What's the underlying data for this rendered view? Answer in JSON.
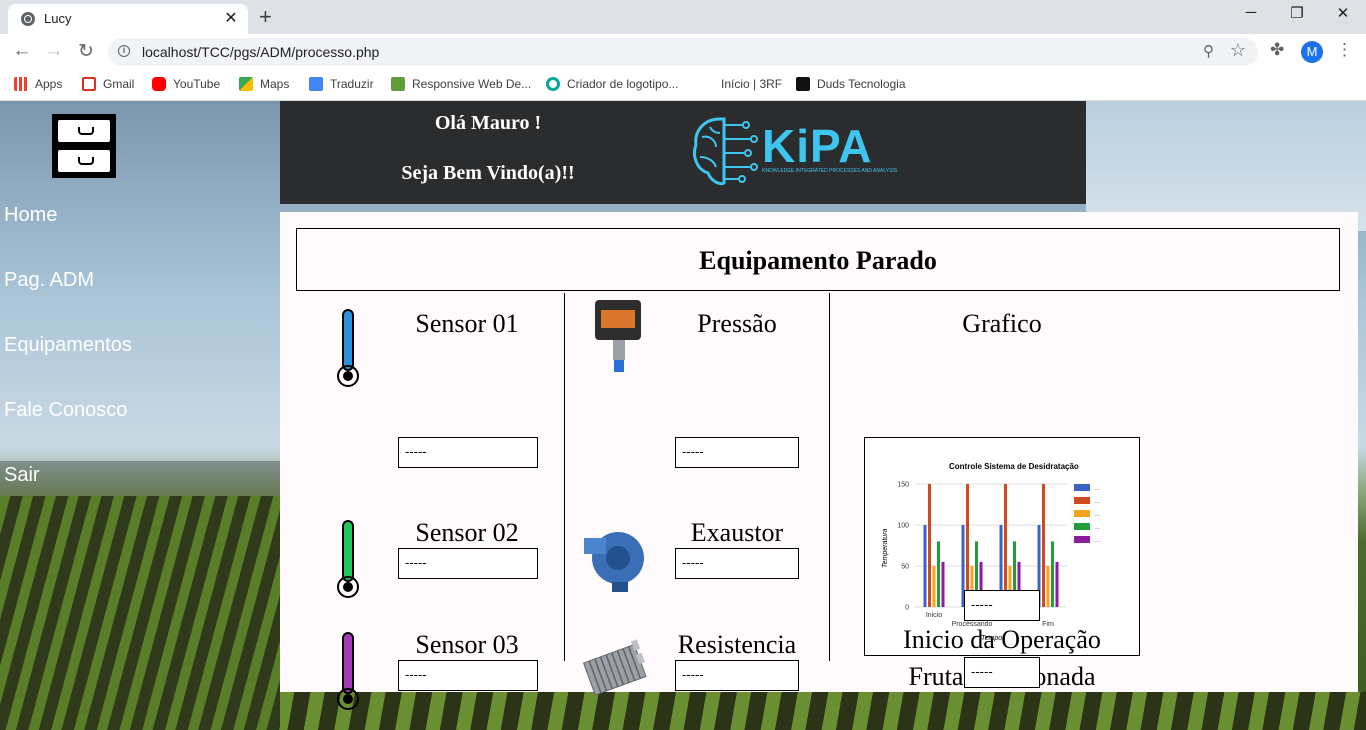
{
  "browser": {
    "tab_title": "Lucy",
    "tab_close": "✕",
    "new_tab": "+",
    "url": "localhost/TCC/pgs/ADM/processo.php",
    "avatar_letter": "M",
    "bookmarks": [
      {
        "label": "Apps",
        "color": "#ea4335"
      },
      {
        "label": "Gmail",
        "color": "#d93025"
      },
      {
        "label": "YouTube",
        "color": "#ff0000"
      },
      {
        "label": "Maps",
        "color": "#34a853"
      },
      {
        "label": "Traduzir",
        "color": "#4285f4"
      },
      {
        "label": "Responsive Web De...",
        "color": "#5f9e3a"
      },
      {
        "label": "Criador de logotipo...",
        "color": "#00a99d"
      },
      {
        "label": "Início | 3RF",
        "color": "#ffffff"
      },
      {
        "label": "Duds Tecnologia",
        "color": "#111111"
      }
    ]
  },
  "sidebar": {
    "items": [
      {
        "label": "Home"
      },
      {
        "label": "Pag. ADM"
      },
      {
        "label": "Equipamentos"
      },
      {
        "label": "Fale Conosco"
      },
      {
        "label": "Sair"
      }
    ]
  },
  "header": {
    "greeting": "Olá Mauro !",
    "welcome": "Seja Bem Vindo(a)!!",
    "logo_text": "KiPA",
    "logo_subtitle": "KNOWLEDGE INTEGRATED PROCESSES AND ANALYSIS",
    "logo_color": "#3ec6f0"
  },
  "main": {
    "status": "Equipamento Parado",
    "sensors": [
      {
        "label": "Sensor 01",
        "value": "-----",
        "color": "#2f8fd8"
      },
      {
        "label": "Sensor 02",
        "value": "-----",
        "color": "#22c55e"
      },
      {
        "label": "Sensor 03",
        "value": "-----",
        "color": "#a23bb8"
      }
    ],
    "equipment": [
      {
        "label": "Pressão",
        "value": "-----"
      },
      {
        "label": "Exaustor",
        "value": "-----"
      },
      {
        "label": "Resistencia",
        "value": "-----"
      }
    ],
    "chart_title": "Grafico",
    "fruit_label": "Fruta Selecionada",
    "fruit_value": "-----",
    "start_label": "Inicio da Operação",
    "start_value": "-----"
  },
  "chart_data": {
    "type": "bar",
    "title": "Controle Sistema de Desidratação",
    "xlabel": "Tempo",
    "ylabel": "Temperatura",
    "ylim": [
      0,
      150
    ],
    "yticks": [
      0,
      50,
      100,
      150
    ],
    "categories": [
      "Inicio",
      "Processando",
      "Processando",
      "Fim"
    ],
    "series": [
      {
        "name": "...",
        "color": "#3b62c4",
        "values": [
          100,
          100,
          100,
          100
        ]
      },
      {
        "name": "...",
        "color": "#d04a1f",
        "values": [
          150,
          150,
          150,
          150
        ]
      },
      {
        "name": "...",
        "color": "#f7a21b",
        "values": [
          50,
          50,
          50,
          50
        ]
      },
      {
        "name": "...",
        "color": "#1f9e3a",
        "values": [
          80,
          80,
          80,
          80
        ]
      },
      {
        "name": "...",
        "color": "#8e1aa0",
        "values": [
          55,
          55,
          55,
          55
        ]
      }
    ],
    "legend": "right"
  }
}
